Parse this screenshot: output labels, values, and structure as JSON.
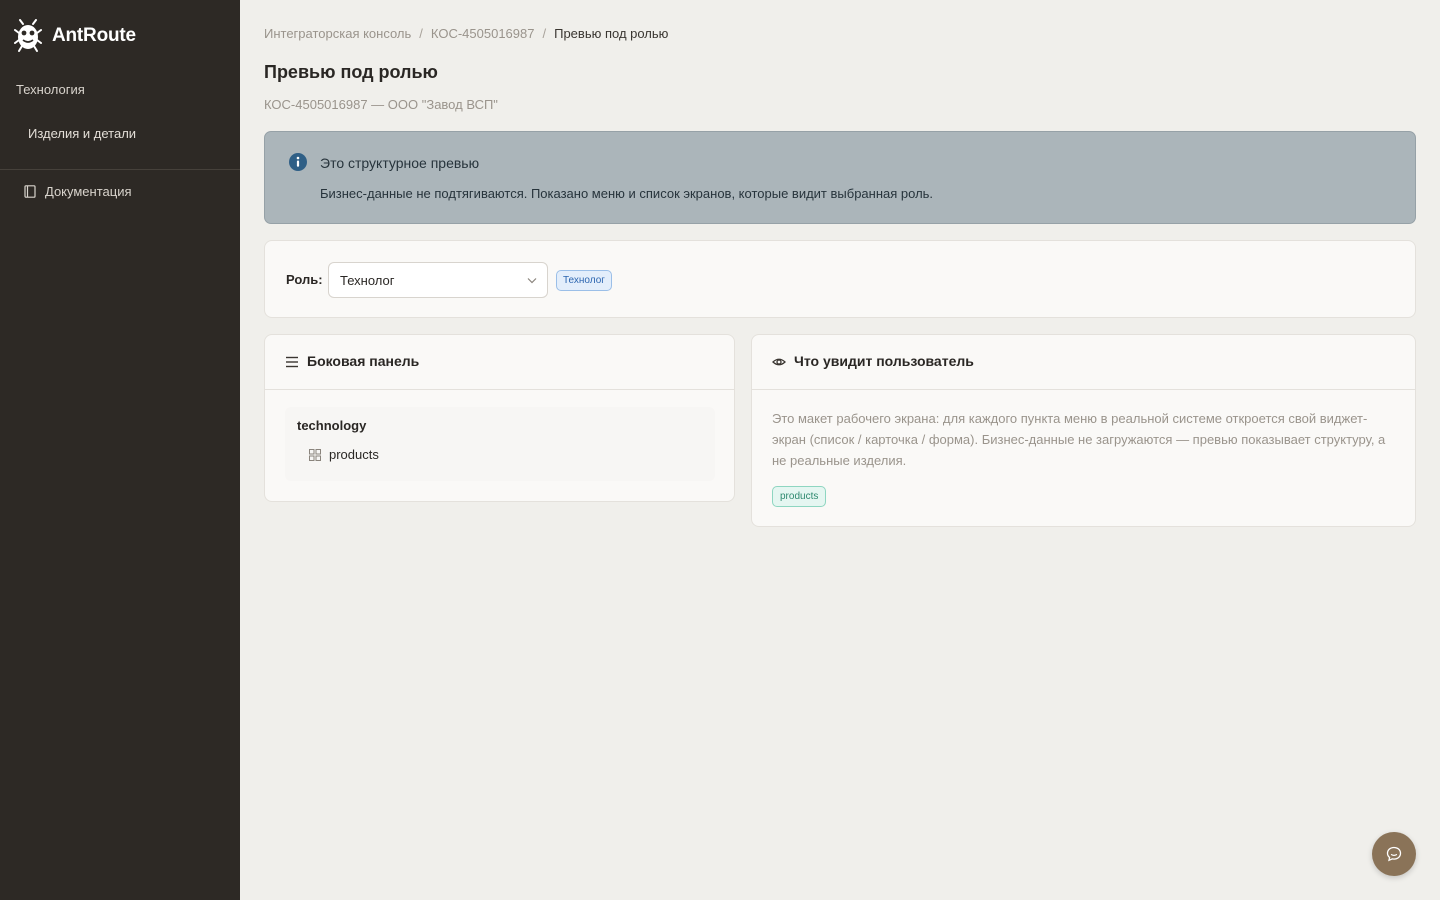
{
  "brand": {
    "name": "AntRoute"
  },
  "sidebar": {
    "group_label": "Технология",
    "items": [
      {
        "label": "Изделия и детали"
      }
    ],
    "docs_label": "Документация"
  },
  "breadcrumb": {
    "items": [
      "Интеграторская консоль",
      "КОС-4505016987"
    ],
    "current": "Превью под ролью",
    "separator": "/"
  },
  "page": {
    "title": "Превью под ролью",
    "subtitle": "КОС-4505016987 — ООО \"Завод ВСП\""
  },
  "alert": {
    "title": "Это структурное превью",
    "text": "Бизнес-данные не подтягиваются. Показано меню и список экранов, которые видит выбранная роль.",
    "bg_color": "#abb5ba"
  },
  "role": {
    "label": "Роль:",
    "selected": "Технолог",
    "badge": "Технолог"
  },
  "sidebar_panel": {
    "title": "Боковая панель",
    "group": "technology",
    "items": [
      "products"
    ]
  },
  "user_view_panel": {
    "title": "Что увидит пользователь",
    "description": "Это макет рабочего экрана: для каждого пункта меню в реальной системе откроется свой виджет-экран (список / карточка / форма). Бизнес-данные не загружаются — превью показывает структуру, а не реальные изделия.",
    "tags": [
      "products"
    ]
  },
  "colors": {
    "sidebar_bg": "#2d2925",
    "page_bg": "#f0efeb",
    "chat_button": "#8a7358"
  },
  "icons": {
    "logo": "ant-logo-icon",
    "docs": "book-icon",
    "info": "info-icon",
    "menu": "hamburger-icon",
    "eye": "eye-icon",
    "grid": "grid-icon",
    "chevron": "chevron-down-icon",
    "chat": "chat-icon"
  }
}
